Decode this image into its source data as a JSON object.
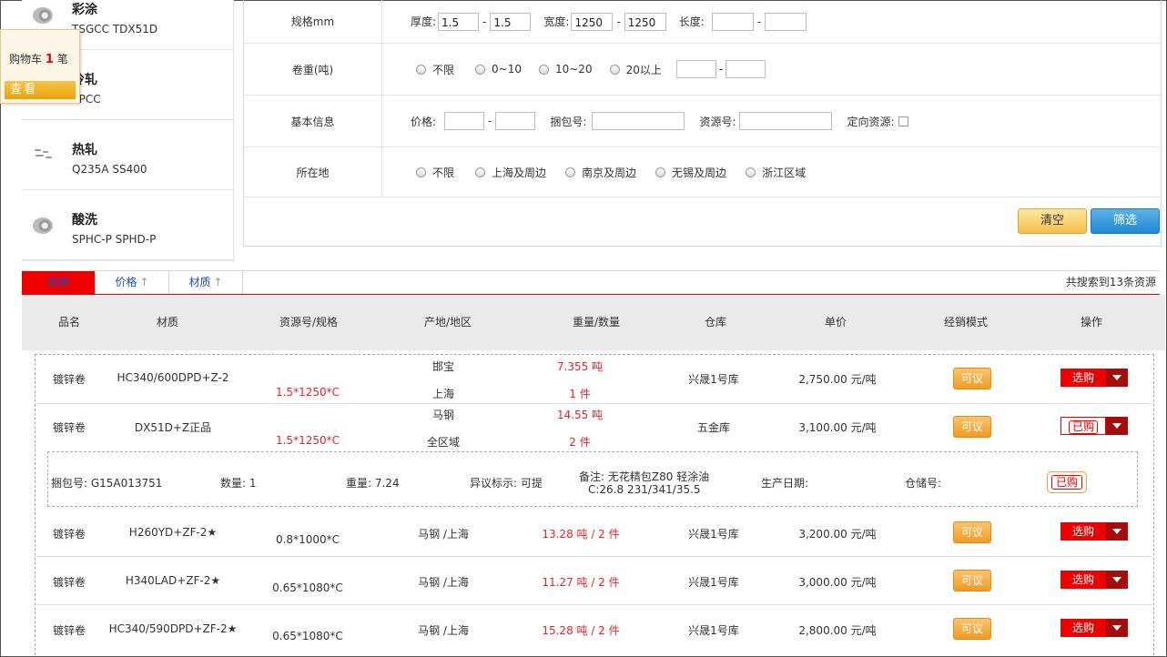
{
  "categories": [
    {
      "name": "彩涂",
      "sub": "TSGCC TDX51D",
      "icon": "coil-icon"
    },
    {
      "name": "冷轧",
      "sub": "SPCC",
      "icon": "coil-icon"
    },
    {
      "name": "热轧",
      "sub": "Q235A SS400",
      "icon": "strip-icon"
    },
    {
      "name": "酸洗",
      "sub": "SPHC-P SPHD-P",
      "icon": "coil-icon"
    }
  ],
  "cart": {
    "label": "购物车",
    "count": "1",
    "unit": "笔",
    "view": "查看"
  },
  "filter": {
    "spec": {
      "label": "规格mm",
      "thickness_label": "厚度:",
      "thickness_min": "1.5",
      "thickness_max": "1.5",
      "width_label": "宽度:",
      "width_min": "1250",
      "width_max": "1250",
      "length_label": "长度:",
      "length_min": "",
      "length_max": ""
    },
    "weight": {
      "label": "卷重(吨)",
      "options": [
        "不限",
        "0~10",
        "10~20",
        "20以上"
      ],
      "min": "",
      "max": ""
    },
    "basic": {
      "label": "基本信息",
      "price_label": "价格:",
      "price_min": "",
      "price_max": "",
      "bundle_label": "捆包号:",
      "bundle": "",
      "resource_label": "资源号:",
      "resource": "",
      "directed_label": "定向资源:"
    },
    "location": {
      "label": "所在地",
      "options": [
        "不限",
        "上海及周边",
        "南京及周边",
        "无锡及周边",
        "浙江区域"
      ]
    },
    "clear_label": "清空",
    "filter_label": "筛选",
    "dash": "-"
  },
  "sort": {
    "tabs": [
      "规格",
      "价格",
      "材质"
    ],
    "arrow": "↑",
    "result": "共搜索到13条资源"
  },
  "table": {
    "headers": [
      "品名",
      "材质",
      "资源号/规格",
      "产地/地区",
      "重量/数量",
      "仓库",
      "单价",
      "经销模式",
      "操作"
    ],
    "rows": [
      {
        "name": "镀锌卷",
        "material": "HC340/600DPD+Z-2",
        "spec": "1.5*1250*C",
        "origin": "邯宝",
        "region": "上海",
        "weight": "7.355 吨",
        "qty": "1 件",
        "warehouse": "兴晟1号库",
        "price": "2,750.00 元/吨",
        "mode": "可议",
        "action": "选购",
        "bought": false
      },
      {
        "name": "镀锌卷",
        "material": "DX51D+Z正品",
        "spec": "1.5*1250*C",
        "origin": "马钢",
        "region": "全区域",
        "weight": "14.55 吨",
        "qty": "2 件",
        "warehouse": "五金库",
        "price": "3,100.00 元/吨",
        "mode": "可议",
        "action": "已购",
        "bought": true
      },
      {
        "name": "镀锌卷",
        "material": "H260YD+ZF-2★",
        "spec": "0.8*1000*C",
        "origin_region": "马钢 /上海",
        "weight_qty": "13.28 吨  / 2 件",
        "warehouse": "兴晟1号库",
        "price": "3,200.00 元/吨",
        "mode": "可议",
        "action": "选购"
      },
      {
        "name": "镀锌卷",
        "material": "H340LAD+ZF-2★",
        "spec": "0.65*1080*C",
        "origin_region": "马钢 /上海",
        "weight_qty": "11.27 吨  / 2 件",
        "warehouse": "兴晟1号库",
        "price": "3,000.00 元/吨",
        "mode": "可议",
        "action": "选购"
      },
      {
        "name": "镀锌卷",
        "material": "HC340/590DPD+ZF-2★",
        "spec": "0.65*1080*C",
        "origin_region": "马钢 /上海",
        "weight_qty": "15.28 吨  / 2 件",
        "warehouse": "兴晟1号库",
        "price": "2,800.00 元/吨",
        "mode": "可议",
        "action": "选购"
      }
    ],
    "detail": {
      "bundle": "捆包号: G15A013751",
      "qty": "数量: 1",
      "weight": "重量: 7.24",
      "objection": "异议标示: 可提",
      "remark1": "备注: 无花精包Z80 轻涂油",
      "remark2": "C:26.8 231/341/35.5",
      "prod_date": "生产日期:",
      "storage": "仓储号:",
      "bought": "已购"
    }
  }
}
